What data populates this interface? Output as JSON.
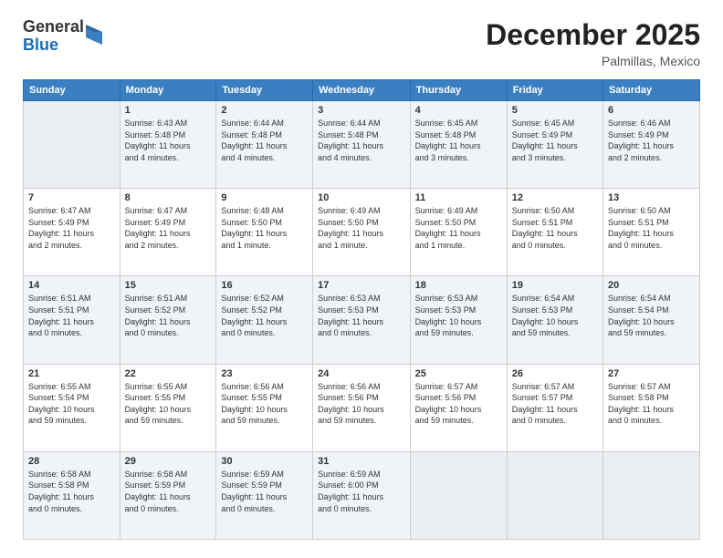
{
  "header": {
    "logo": {
      "general": "General",
      "blue": "Blue"
    },
    "title": "December 2025",
    "location": "Palmillas, Mexico"
  },
  "columns": [
    "Sunday",
    "Monday",
    "Tuesday",
    "Wednesday",
    "Thursday",
    "Friday",
    "Saturday"
  ],
  "weeks": [
    [
      {
        "day": "",
        "info": ""
      },
      {
        "day": "1",
        "info": "Sunrise: 6:43 AM\nSunset: 5:48 PM\nDaylight: 11 hours\nand 4 minutes."
      },
      {
        "day": "2",
        "info": "Sunrise: 6:44 AM\nSunset: 5:48 PM\nDaylight: 11 hours\nand 4 minutes."
      },
      {
        "day": "3",
        "info": "Sunrise: 6:44 AM\nSunset: 5:48 PM\nDaylight: 11 hours\nand 4 minutes."
      },
      {
        "day": "4",
        "info": "Sunrise: 6:45 AM\nSunset: 5:48 PM\nDaylight: 11 hours\nand 3 minutes."
      },
      {
        "day": "5",
        "info": "Sunrise: 6:45 AM\nSunset: 5:49 PM\nDaylight: 11 hours\nand 3 minutes."
      },
      {
        "day": "6",
        "info": "Sunrise: 6:46 AM\nSunset: 5:49 PM\nDaylight: 11 hours\nand 2 minutes."
      }
    ],
    [
      {
        "day": "7",
        "info": "Sunrise: 6:47 AM\nSunset: 5:49 PM\nDaylight: 11 hours\nand 2 minutes."
      },
      {
        "day": "8",
        "info": "Sunrise: 6:47 AM\nSunset: 5:49 PM\nDaylight: 11 hours\nand 2 minutes."
      },
      {
        "day": "9",
        "info": "Sunrise: 6:48 AM\nSunset: 5:50 PM\nDaylight: 11 hours\nand 1 minute."
      },
      {
        "day": "10",
        "info": "Sunrise: 6:49 AM\nSunset: 5:50 PM\nDaylight: 11 hours\nand 1 minute."
      },
      {
        "day": "11",
        "info": "Sunrise: 6:49 AM\nSunset: 5:50 PM\nDaylight: 11 hours\nand 1 minute."
      },
      {
        "day": "12",
        "info": "Sunrise: 6:50 AM\nSunset: 5:51 PM\nDaylight: 11 hours\nand 0 minutes."
      },
      {
        "day": "13",
        "info": "Sunrise: 6:50 AM\nSunset: 5:51 PM\nDaylight: 11 hours\nand 0 minutes."
      }
    ],
    [
      {
        "day": "14",
        "info": "Sunrise: 6:51 AM\nSunset: 5:51 PM\nDaylight: 11 hours\nand 0 minutes."
      },
      {
        "day": "15",
        "info": "Sunrise: 6:51 AM\nSunset: 5:52 PM\nDaylight: 11 hours\nand 0 minutes."
      },
      {
        "day": "16",
        "info": "Sunrise: 6:52 AM\nSunset: 5:52 PM\nDaylight: 11 hours\nand 0 minutes."
      },
      {
        "day": "17",
        "info": "Sunrise: 6:53 AM\nSunset: 5:53 PM\nDaylight: 11 hours\nand 0 minutes."
      },
      {
        "day": "18",
        "info": "Sunrise: 6:53 AM\nSunset: 5:53 PM\nDaylight: 10 hours\nand 59 minutes."
      },
      {
        "day": "19",
        "info": "Sunrise: 6:54 AM\nSunset: 5:53 PM\nDaylight: 10 hours\nand 59 minutes."
      },
      {
        "day": "20",
        "info": "Sunrise: 6:54 AM\nSunset: 5:54 PM\nDaylight: 10 hours\nand 59 minutes."
      }
    ],
    [
      {
        "day": "21",
        "info": "Sunrise: 6:55 AM\nSunset: 5:54 PM\nDaylight: 10 hours\nand 59 minutes."
      },
      {
        "day": "22",
        "info": "Sunrise: 6:55 AM\nSunset: 5:55 PM\nDaylight: 10 hours\nand 59 minutes."
      },
      {
        "day": "23",
        "info": "Sunrise: 6:56 AM\nSunset: 5:55 PM\nDaylight: 10 hours\nand 59 minutes."
      },
      {
        "day": "24",
        "info": "Sunrise: 6:56 AM\nSunset: 5:56 PM\nDaylight: 10 hours\nand 59 minutes."
      },
      {
        "day": "25",
        "info": "Sunrise: 6:57 AM\nSunset: 5:56 PM\nDaylight: 10 hours\nand 59 minutes."
      },
      {
        "day": "26",
        "info": "Sunrise: 6:57 AM\nSunset: 5:57 PM\nDaylight: 11 hours\nand 0 minutes."
      },
      {
        "day": "27",
        "info": "Sunrise: 6:57 AM\nSunset: 5:58 PM\nDaylight: 11 hours\nand 0 minutes."
      }
    ],
    [
      {
        "day": "28",
        "info": "Sunrise: 6:58 AM\nSunset: 5:58 PM\nDaylight: 11 hours\nand 0 minutes."
      },
      {
        "day": "29",
        "info": "Sunrise: 6:58 AM\nSunset: 5:59 PM\nDaylight: 11 hours\nand 0 minutes."
      },
      {
        "day": "30",
        "info": "Sunrise: 6:59 AM\nSunset: 5:59 PM\nDaylight: 11 hours\nand 0 minutes."
      },
      {
        "day": "31",
        "info": "Sunrise: 6:59 AM\nSunset: 6:00 PM\nDaylight: 11 hours\nand 0 minutes."
      },
      {
        "day": "",
        "info": ""
      },
      {
        "day": "",
        "info": ""
      },
      {
        "day": "",
        "info": ""
      }
    ]
  ]
}
